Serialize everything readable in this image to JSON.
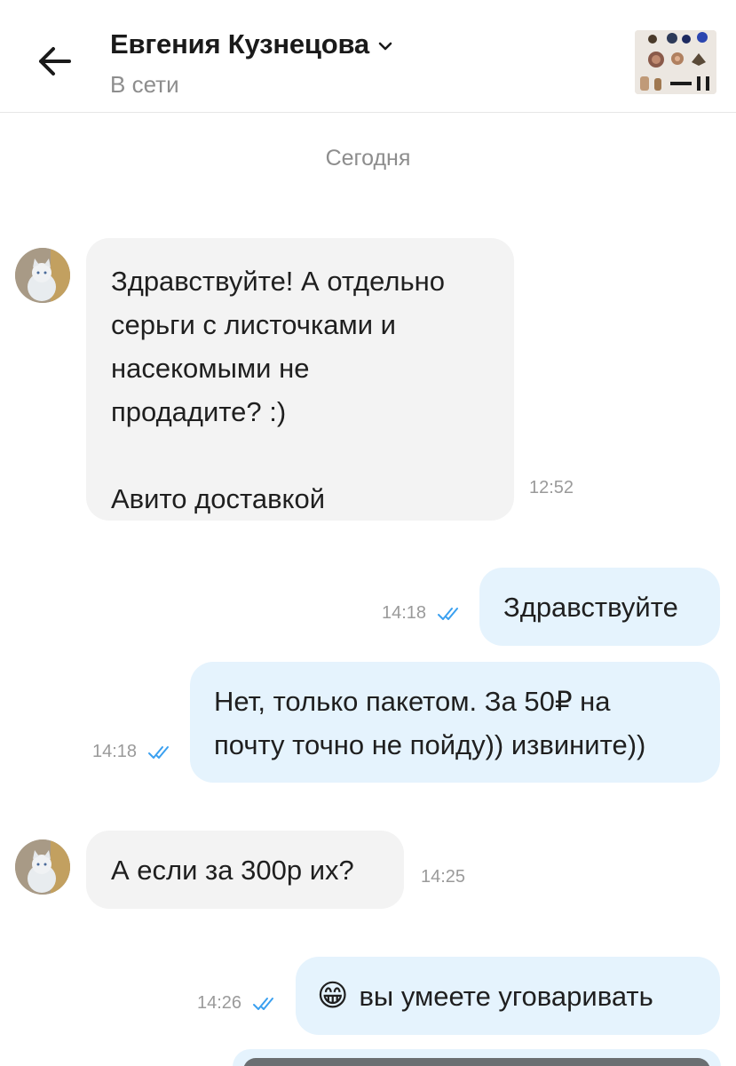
{
  "header": {
    "contact_name": "Евгения Кузнецова",
    "status": "В сети",
    "back_icon": "arrow-left-icon",
    "dropdown_icon": "chevron-down-icon"
  },
  "date_separator": "Сегодня",
  "colors": {
    "incoming_bubble": "#f3f3f3",
    "outgoing_bubble": "#e5f3fd",
    "read_ticks": "#3aa0f0",
    "muted_text": "#8d8d8d"
  },
  "messages": [
    {
      "direction": "incoming",
      "text": "Здравствуйте! А отдельно\nсерьги с листочками и\nнасекомыми не\nпродадите? :)\n\nАвито доставкой",
      "time": "12:52"
    },
    {
      "direction": "outgoing",
      "text": "Здравствуйте",
      "time": "14:18",
      "read": true
    },
    {
      "direction": "outgoing",
      "text": "Нет, только пакетом. За 50₽ на\nпочту точно не пойду)) извините))",
      "time": "14:18",
      "read": true
    },
    {
      "direction": "incoming",
      "text": "А если за 300р их?",
      "time": "14:25"
    },
    {
      "direction": "outgoing",
      "emoji": "😁",
      "text": "вы умеете уговаривать",
      "time": "14:26",
      "read": true
    }
  ]
}
